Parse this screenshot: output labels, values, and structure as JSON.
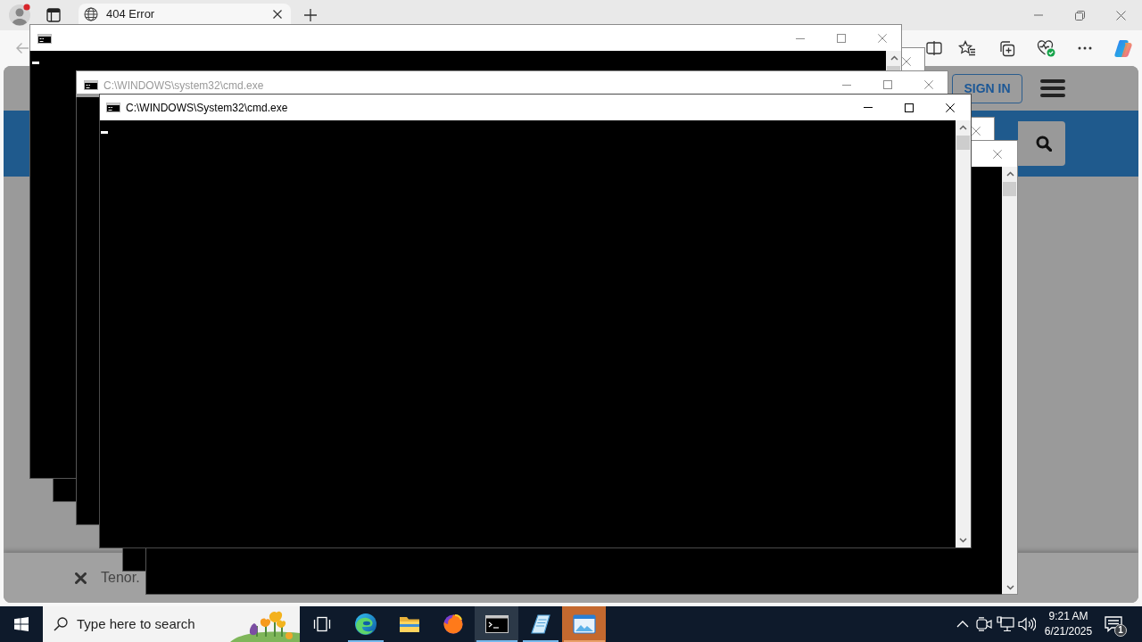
{
  "browser": {
    "tabs": [
      {
        "title": "404 Error",
        "selected": true
      }
    ],
    "page": {
      "sign_in_button": "SIGN IN",
      "footer_text": "Tenor."
    }
  },
  "windows": [
    {
      "active": false,
      "cursor": true
    },
    {
      "active": false
    },
    {
      "active": false,
      "title": "C:\\WINDOWS\\system32\\cmd.exe",
      "cursor": false
    },
    {
      "active": true,
      "title": "C:\\WINDOWS\\System32\\cmd.exe",
      "cursor": true
    },
    {
      "active": false
    },
    {
      "active": false
    }
  ],
  "taskbar": {
    "search": {
      "placeholder": "Type here to search"
    },
    "apps": [
      {
        "kind": "task-view",
        "running": false,
        "active": false,
        "flashing": false
      },
      {
        "kind": "edge",
        "running": true,
        "active": false,
        "flashing": false
      },
      {
        "kind": "explorer",
        "running": false,
        "active": false,
        "flashing": false
      },
      {
        "kind": "firefox",
        "running": false,
        "active": false,
        "flashing": false
      },
      {
        "kind": "console",
        "running": true,
        "active": true,
        "flashing": false
      },
      {
        "kind": "notepad",
        "running": true,
        "active": false,
        "flashing": false
      },
      {
        "kind": "picture-app",
        "running": true,
        "active": false,
        "flashing": true
      }
    ],
    "clock": {
      "time": "9:21 AM",
      "date": "6/21/2025"
    },
    "notification_count": "1"
  }
}
